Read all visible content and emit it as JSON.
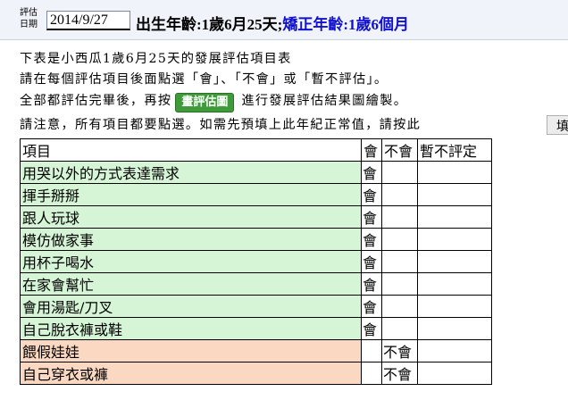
{
  "header": {
    "eval_label": "評估\n日期",
    "date_value": "2014/9/27",
    "birth_age": "出生年齡:1歲6月25天;",
    "corrected_age": "矯正年齡:1歲6個月"
  },
  "instructions": {
    "line1": "下表是小西瓜1歲6月25天的發展評估項目表",
    "line2": "請在每個評估項目後面點選「會」、「不會」或「暫不評估」。",
    "line3_prefix": "全部都評估完畢後，再按",
    "draw_button": "畫評估圖",
    "line3_suffix": "進行發展評估結果圖繪製。",
    "line4": "請注意，所有項目都要點選。如需先預填上此年紀正常值，請按此",
    "fill_button": "填"
  },
  "table": {
    "headers": {
      "item": "項目",
      "can": "會",
      "cannot": "不會",
      "skip": "暫不評定"
    },
    "rows": [
      {
        "item": "用哭以外的方式表達需求",
        "can": "會",
        "cannot": "",
        "skip": "",
        "color": "green"
      },
      {
        "item": "揮手掰掰",
        "can": "會",
        "cannot": "",
        "skip": "",
        "color": "green"
      },
      {
        "item": "跟人玩球",
        "can": "會",
        "cannot": "",
        "skip": "",
        "color": "green"
      },
      {
        "item": "模仿做家事",
        "can": "會",
        "cannot": "",
        "skip": "",
        "color": "green"
      },
      {
        "item": "用杯子喝水",
        "can": "會",
        "cannot": "",
        "skip": "",
        "color": "green"
      },
      {
        "item": "在家會幫忙",
        "can": "會",
        "cannot": "",
        "skip": "",
        "color": "green"
      },
      {
        "item": "會用湯匙/刀叉",
        "can": "會",
        "cannot": "",
        "skip": "",
        "color": "green"
      },
      {
        "item": "自己脫衣褲或鞋",
        "can": "會",
        "cannot": "",
        "skip": "",
        "color": "green"
      },
      {
        "item": "餵假娃娃",
        "can": "",
        "cannot": "不會",
        "skip": "",
        "color": "orange"
      },
      {
        "item": "自己穿衣或褲",
        "can": "",
        "cannot": "不會",
        "skip": "",
        "color": "orange"
      }
    ]
  },
  "colors": {
    "green_row": "#d6f5d6",
    "orange_row": "#fbd8c2",
    "corrected_age": "#1010d0",
    "button_green": "#3f9a3a"
  }
}
